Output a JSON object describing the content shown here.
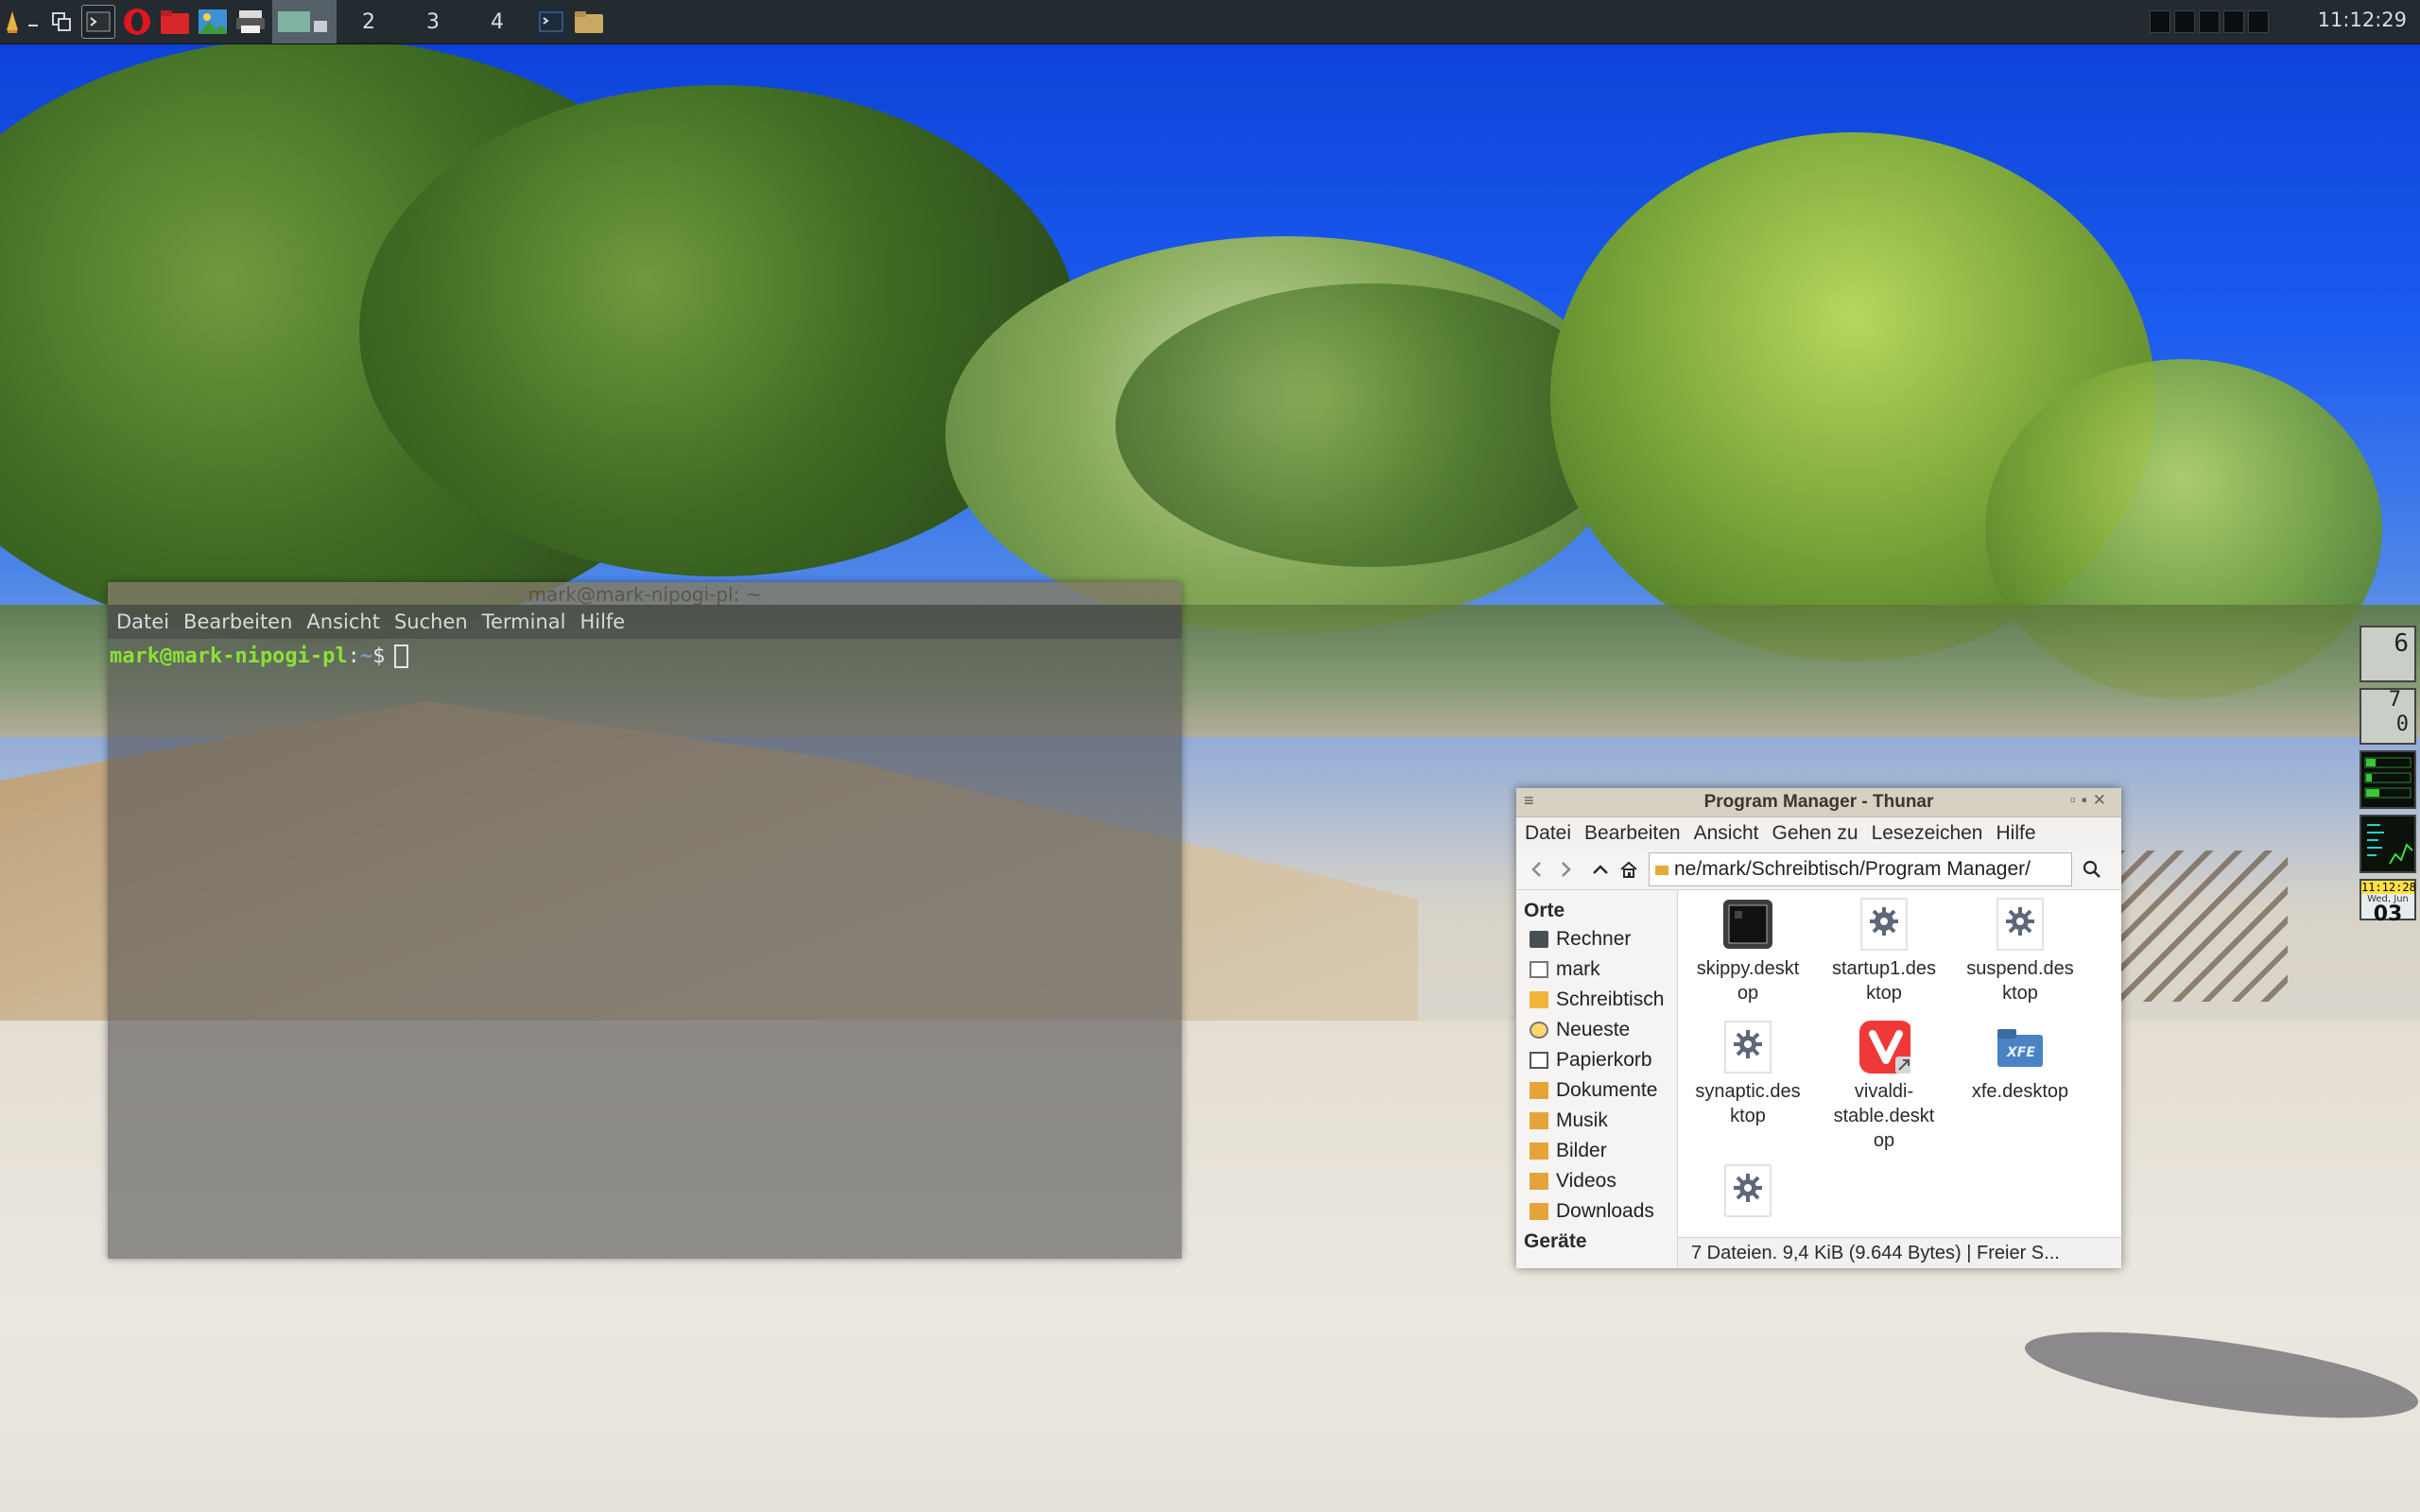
{
  "panel": {
    "workspaces": [
      "2",
      "3",
      "4"
    ],
    "clock": "11:12:29"
  },
  "terminal": {
    "title": "mark@mark-nipogi-pl: ~",
    "menu": [
      "Datei",
      "Bearbeiten",
      "Ansicht",
      "Suchen",
      "Terminal",
      "Hilfe"
    ],
    "prompt_user": "mark@mark-nipogi-pl",
    "prompt_sep": ":",
    "prompt_path": "~",
    "prompt_symbol": "$"
  },
  "thunar": {
    "title": "Program Manager - Thunar",
    "menu": [
      "Datei",
      "Bearbeiten",
      "Ansicht",
      "Gehen zu",
      "Lesezeichen",
      "Hilfe"
    ],
    "path": "ne/mark/Schreibtisch/Program Manager/",
    "sidebar": {
      "places_header": "Orte",
      "places": [
        "Rechner",
        "mark",
        "Schreibtisch",
        "Neueste",
        "Papierkorb",
        "Dokumente",
        "Musik",
        "Bilder",
        "Videos",
        "Downloads"
      ],
      "devices_header": "Geräte"
    },
    "files": [
      {
        "line1": "skippy.deskt",
        "line2": "op",
        "icon": "terminal-app-icon"
      },
      {
        "line1": "startup1.des",
        "line2": "ktop",
        "icon": "gear-icon"
      },
      {
        "line1": "suspend.des",
        "line2": "ktop",
        "icon": "gear-icon"
      },
      {
        "line1": "synaptic.des",
        "line2": "ktop",
        "icon": "gear-icon"
      },
      {
        "line1": "vivaldi-",
        "line2": "stable.deskt",
        "line3": "op",
        "icon": "vivaldi-icon"
      },
      {
        "line1": "xfe.desktop",
        "icon": "xfe-icon"
      },
      {
        "icon": "gear-icon"
      }
    ],
    "status": "7 Dateien. 9,4 KiB (9.644 Bytes)  |  Freier S..."
  },
  "dock": {
    "tile1": "6",
    "tile2a": "7",
    "tile2b": "0",
    "date_time": "11:12:28",
    "date_day": "Wed, Jun",
    "date_num": "03"
  },
  "colors": {
    "panel_bg": "#232a30",
    "terminal_user": "#8ae234",
    "terminal_path": "#729fcf",
    "vivaldi_red": "#ef3939"
  }
}
